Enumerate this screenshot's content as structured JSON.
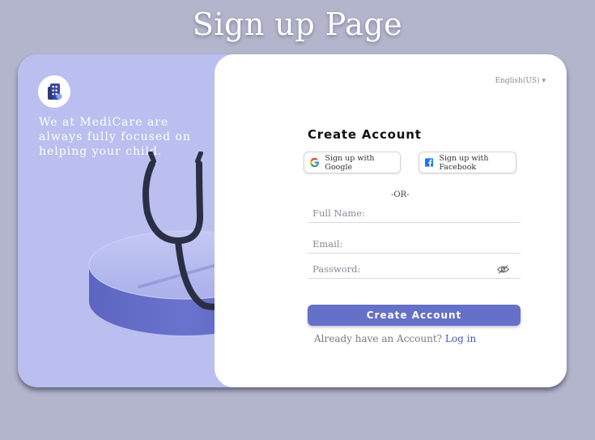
{
  "page": {
    "title": "Sign up Page"
  },
  "left_panel": {
    "logo_icon": "building-logo-icon",
    "tagline": "We at MediCare are always fully focused on helping your child.",
    "illustration": "stethoscope-on-pedestal"
  },
  "form": {
    "language": "English(US)",
    "title": "Create Account",
    "google_label": "Sign up with Google",
    "facebook_label": "Sign up with Facebook",
    "or_text": "-OR-",
    "full_name_placeholder": "Full Name:",
    "email_placeholder": "Email:",
    "password_placeholder": "Password:",
    "submit_label": "Create Account",
    "login_prompt": "Already have an Account?",
    "login_link": "Log in"
  },
  "colors": {
    "background": "#b2b5cb",
    "left_panel": "#babff0",
    "accent": "#6570c9",
    "link": "#4b56bd"
  }
}
